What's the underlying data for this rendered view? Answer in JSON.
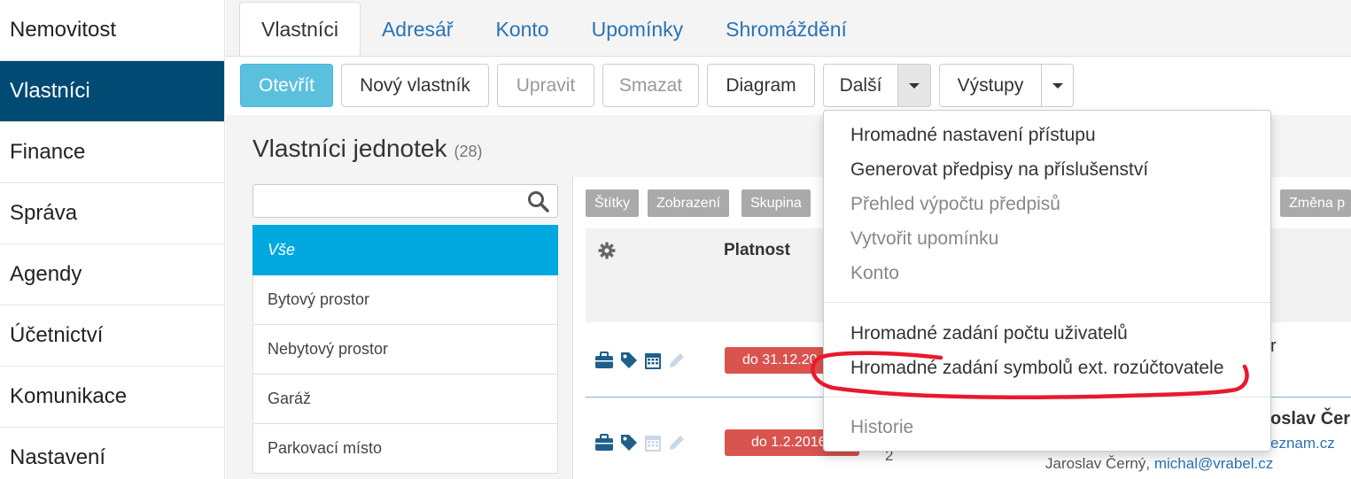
{
  "sidebar": {
    "items": [
      {
        "label": "Nemovitost"
      },
      {
        "label": "Vlastníci"
      },
      {
        "label": "Finance"
      },
      {
        "label": "Správa"
      },
      {
        "label": "Agendy"
      },
      {
        "label": "Účetnictví"
      },
      {
        "label": "Komunikace"
      },
      {
        "label": "Nastavení"
      }
    ],
    "active_index": 1
  },
  "tabs": [
    {
      "label": "Vlastníci"
    },
    {
      "label": "Adresář"
    },
    {
      "label": "Konto"
    },
    {
      "label": "Upomínky"
    },
    {
      "label": "Shromáždění"
    }
  ],
  "toolbar": {
    "open": "Otevřít",
    "new_owner": "Nový vlastník",
    "edit": "Upravit",
    "delete": "Smazat",
    "diagram": "Diagram",
    "more": "Další",
    "outputs": "Výstupy"
  },
  "page": {
    "title": "Vlastníci jednotek",
    "count": "(28)"
  },
  "filters": {
    "search_placeholder": "",
    "items": [
      {
        "label": "Vše"
      },
      {
        "label": "Bytový prostor"
      },
      {
        "label": "Nebytový prostor"
      },
      {
        "label": "Garáž"
      },
      {
        "label": "Parkovací místo"
      }
    ]
  },
  "table": {
    "tag_buttons": [
      {
        "label": "Štítky"
      },
      {
        "label": "Zobrazení"
      },
      {
        "label": "Skupina"
      },
      {
        "label": "Změna p"
      }
    ],
    "header_platnost": "Platnost",
    "rows": [
      {
        "validity": "do 31.12.20",
        "extra": "r"
      },
      {
        "validity": "do 1.2.2016",
        "number": "2",
        "name_partial": "oslav Čern",
        "email_partial": "eznam.cz",
        "contact_name": "Jaroslav Černý,",
        "contact_email": "michal@vrabel.cz"
      }
    ]
  },
  "dropdown": {
    "items": [
      {
        "label": "Hromadné nastavení přístupu",
        "disabled": false
      },
      {
        "label": "Generovat předpisy na příslušenství",
        "disabled": false
      },
      {
        "label": "Přehled výpočtu předpisů",
        "disabled": true
      },
      {
        "label": "Vytvořit upomínku",
        "disabled": true
      },
      {
        "label": "Konto",
        "disabled": true
      },
      {
        "label": "Hromadné zadání počtu uživatelů",
        "disabled": false
      },
      {
        "label": "Hromadné zadání symbolů ext. rozúčtovatele",
        "disabled": false
      },
      {
        "label": "Historie",
        "disabled": true
      }
    ]
  },
  "colors": {
    "sidebar_active": "#004a74",
    "primary_button": "#5bc0de",
    "filter_active": "#00a8e0",
    "badge_red": "#d9534f",
    "link": "#2a72b5",
    "annotation_red": "#e8192c"
  },
  "icons": [
    "search-icon",
    "gear-icon",
    "briefcase-icon",
    "tag-icon",
    "calendar-icon",
    "pencil-icon",
    "caret-down-icon"
  ]
}
